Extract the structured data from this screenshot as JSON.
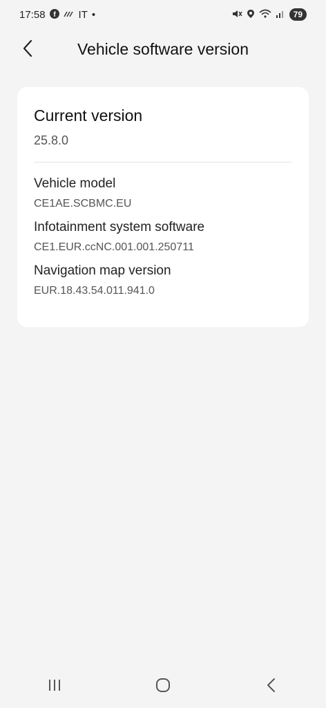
{
  "status_bar": {
    "time": "17:58",
    "carrier": "IT",
    "dot": "•",
    "battery": "79"
  },
  "header": {
    "title": "Vehicle software version"
  },
  "card": {
    "current_title": "Current version",
    "current_value": "25.8.0",
    "rows": [
      {
        "label": "Vehicle model",
        "value": "CE1AE.SCBMC.EU"
      },
      {
        "label": "Infotainment system software",
        "value": "CE1.EUR.ccNC.001.001.250711"
      },
      {
        "label": "Navigation map version",
        "value": "EUR.18.43.54.011.941.0"
      }
    ]
  },
  "icons": {
    "back": "chevron-left-icon",
    "recents": "recents-icon",
    "home": "home-icon",
    "nav_back": "back-icon"
  },
  "colors": {
    "background": "#f4f4f4",
    "card": "#ffffff",
    "text_primary": "#111111",
    "text_secondary": "#555555"
  }
}
